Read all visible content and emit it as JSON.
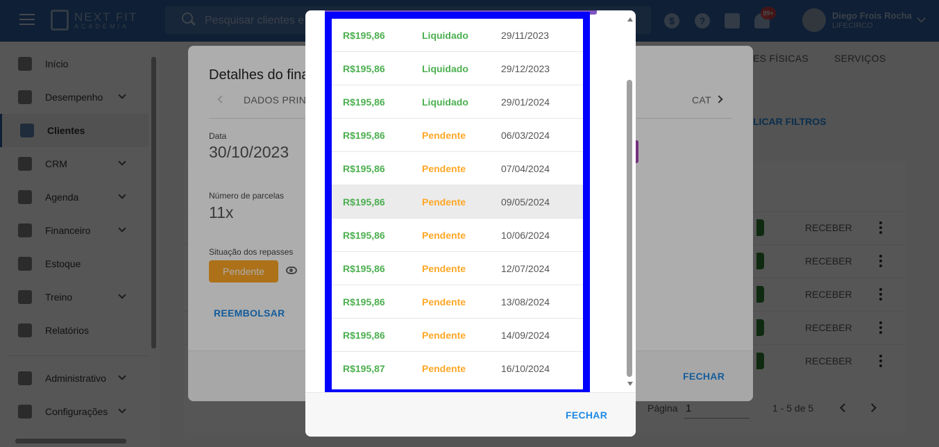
{
  "app": {
    "logo_text": "NEXT FIT",
    "logo_sub": "ACADEMIA",
    "search_placeholder": "Pesquisar clientes e",
    "notification_badge": "99+",
    "user_name": "Diego Frois Rocha",
    "user_org": "LIFECIRCO"
  },
  "sidebar": {
    "items": [
      {
        "label": "Início",
        "icon": "home-icon",
        "has_submenu": false,
        "active": false
      },
      {
        "label": "Desempenho",
        "icon": "chart-line-icon",
        "has_submenu": true,
        "active": false
      },
      {
        "label": "Clientes",
        "icon": "people-icon",
        "has_submenu": false,
        "active": true
      },
      {
        "label": "CRM",
        "icon": "crm-icon",
        "has_submenu": true,
        "active": false
      },
      {
        "label": "Agenda",
        "icon": "calendar-icon",
        "has_submenu": true,
        "active": false
      },
      {
        "label": "Financeiro",
        "icon": "money-icon",
        "has_submenu": true,
        "active": false
      },
      {
        "label": "Estoque",
        "icon": "cart-icon",
        "has_submenu": false,
        "active": false
      },
      {
        "label": "Treino",
        "icon": "dumbbell-icon",
        "has_submenu": true,
        "active": false
      },
      {
        "label": "Relatórios",
        "icon": "report-icon",
        "has_submenu": false,
        "active": false
      },
      {
        "label": "Administrativo",
        "icon": "id-card-icon",
        "has_submenu": true,
        "active": false
      },
      {
        "label": "Configurações",
        "icon": "gear-icon",
        "has_submenu": true,
        "active": false
      }
    ]
  },
  "main": {
    "tabs": [
      "ES FÍSICAS",
      "SERVIÇOS"
    ],
    "apply_filters": "LICAR FILTROS",
    "rows": [
      {
        "action": "RECEBER"
      },
      {
        "action": "RECEBER"
      },
      {
        "action": "RECEBER"
      },
      {
        "action": "RECEBER"
      },
      {
        "action": "RECEBER"
      }
    ],
    "pagination": {
      "label": "Página",
      "value": "1",
      "range": "1 - 5 de 5"
    }
  },
  "details_dialog": {
    "title": "Detalhes do fina",
    "tab_main": "DADOS PRINC",
    "tab_cat": "CAT",
    "date_label": "Data",
    "date_value": "30/10/2023",
    "installments_label": "Número de parcelas",
    "installments_value": "11x",
    "transfer_status_label": "Situação dos repasses",
    "transfer_status_value": "Pendente",
    "refund_button": "REEMBOLSAR",
    "close_button": "FECHAR"
  },
  "installments_dialog": {
    "close_button": "FECHAR",
    "colors": {
      "paid": "#4caf50",
      "pending": "#ffa726",
      "highlight_border": "#0000ff"
    },
    "rows": [
      {
        "amount": "R$195,86",
        "status": "Liquidado",
        "date": "29/11/2023"
      },
      {
        "amount": "R$195,86",
        "status": "Liquidado",
        "date": "29/12/2023"
      },
      {
        "amount": "R$195,86",
        "status": "Liquidado",
        "date": "29/01/2024"
      },
      {
        "amount": "R$195,86",
        "status": "Pendente",
        "date": "06/03/2024"
      },
      {
        "amount": "R$195,86",
        "status": "Pendente",
        "date": "07/04/2024"
      },
      {
        "amount": "R$195,86",
        "status": "Pendente",
        "date": "09/05/2024"
      },
      {
        "amount": "R$195,86",
        "status": "Pendente",
        "date": "10/06/2024"
      },
      {
        "amount": "R$195,86",
        "status": "Pendente",
        "date": "12/07/2024"
      },
      {
        "amount": "R$195,86",
        "status": "Pendente",
        "date": "13/08/2024"
      },
      {
        "amount": "R$195,86",
        "status": "Pendente",
        "date": "14/09/2024"
      },
      {
        "amount": "R$195,87",
        "status": "Pendente",
        "date": "16/10/2024"
      }
    ]
  }
}
